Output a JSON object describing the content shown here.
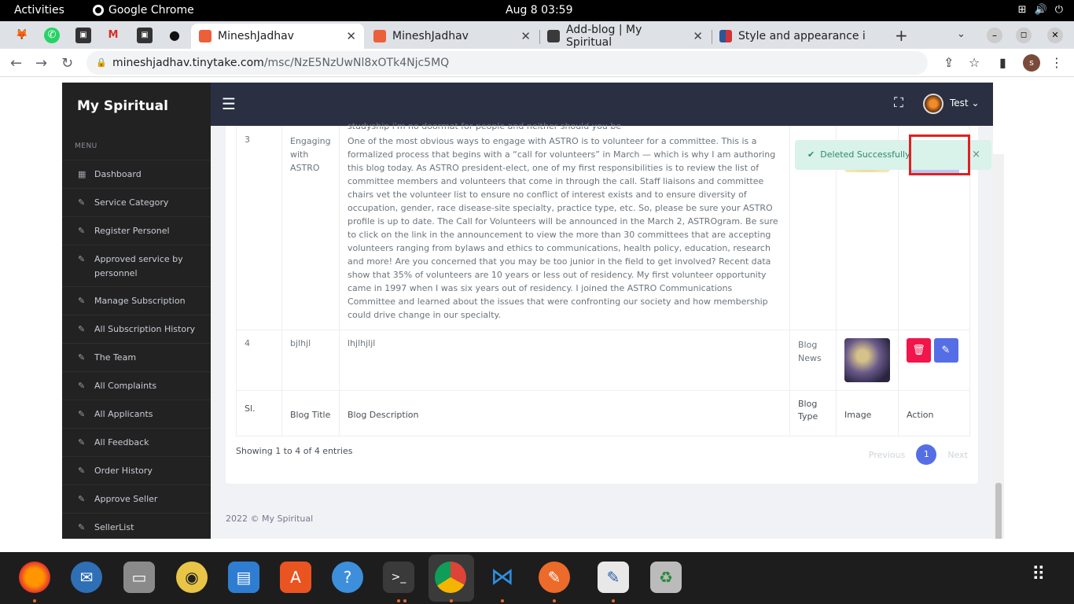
{
  "system": {
    "activities": "Activities",
    "app_name": "Google Chrome",
    "clock": "Aug 8  03:59"
  },
  "browser": {
    "tabs": [
      {
        "title": "MineshJadhav",
        "active": true
      },
      {
        "title": "MineshJadhav",
        "active": false
      },
      {
        "title": "Add-blog | My Spiritual",
        "active": false
      },
      {
        "title": "Style and appearance i",
        "active": false
      }
    ],
    "new_tab": "+",
    "url_host": "mineshjadhav.tinytake.com",
    "url_path": "/msc/NzE5NzUwNl8xOTk4Njc5MQ",
    "profile_initial": "s"
  },
  "app": {
    "brand": "My Spiritual",
    "menu_label": "MENU",
    "menu_items": [
      "Dashboard",
      "Service Category",
      "Register Personel",
      "Approved service by personnel",
      "Manage Subscription",
      "All Subscription History",
      "The Team",
      "All Complaints",
      "All Applicants",
      "All Feedback",
      "Order History",
      "Approve Seller",
      "SellerList"
    ],
    "user_name": "Test",
    "cut_text": "studyship i'm no doormat for people and neither should you be",
    "rows": [
      {
        "sl": "3",
        "title": "Engaging with ASTRO",
        "description": "One of the most obvious ways to engage with ASTRO is to volunteer for a committee. This is a formalized process that begins with a “call for volunteers” in March — which is why I am authoring this blog today. As ASTRO president-elect, one of my first responsibilities is to review the list of committee members and volunteers that come in through the call. Staff liaisons and committee chairs vet the volunteer list to ensure no conflict of interest exists and to ensure diversity of occupation, gender, race disease-site specialty, practice type, etc. So, please be sure your ASTRO profile is up to date. The Call for Volunteers will be announced in the March 2, ASTROgram. Be sure to click on the link in the announcement to view the more than 30 committees that are accepting volunteers ranging from bylaws and ethics to communications, health policy, education, research and more! Are you concerned that you may be too junior in the field to get involved? Recent data show that 35% of volunteers are 10 years or less out of residency. My first volunteer opportunity came in 1997 when I was six years out of residency. I joined the ASTRO Communications Committee and learned about the issues that were confronting our society and how membership could drive change in our specialty.",
        "type": ""
      },
      {
        "sl": "4",
        "title": "bjlhjl",
        "description": "lhjlhjljl",
        "type": "Blog News"
      }
    ],
    "columns": [
      "Sl.",
      "Blog Title",
      "Blog Description",
      "Blog Type",
      "Image",
      "Action"
    ],
    "showing": "Showing 1 to 4 of 4 entries",
    "pager": {
      "prev": "Previous",
      "page": "1",
      "next": "Next"
    },
    "footer": "2022 © My Spiritual",
    "toast": "Deleted Successfully",
    "toast_close": "×"
  },
  "colors": {
    "sidebar": "#222222",
    "header": "#2a3042",
    "accent": "#556ee6",
    "danger": "#f1154b",
    "toast_bg": "#d9f2ea",
    "highlight": "#e02020"
  },
  "icons": {
    "menu": "hamburger-icon",
    "fullscreen": "fullscreen-icon",
    "delete": "trash-icon",
    "edit": "edit-icon"
  }
}
